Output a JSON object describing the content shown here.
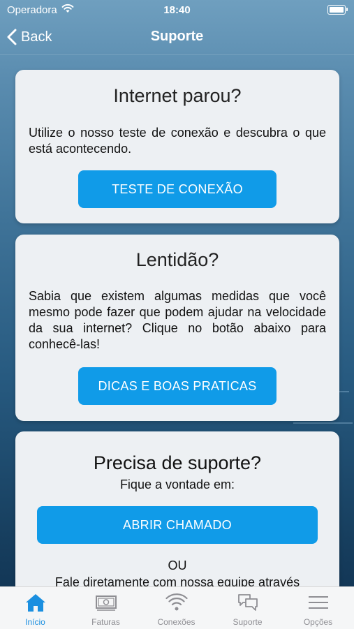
{
  "status_bar": {
    "carrier": "Operadora",
    "time": "18:40"
  },
  "nav": {
    "back_label": "Back",
    "title": "Suporte"
  },
  "cards": {
    "internet": {
      "title": "Internet parou?",
      "text": "Utilize o nosso teste de conexão e descubra o que está acontecendo.",
      "button": "TESTE DE CONEXÃO"
    },
    "lentidao": {
      "title": "Lentidão?",
      "text": "Sabia que existem algumas medidas que você mesmo pode fazer que podem ajudar na velocidade da sua internet? Clique no botão abaixo para conhecê-las!",
      "button": "DICAS E BOAS PRATICAS"
    },
    "suporte": {
      "title": "Precisa de suporte?",
      "subtitle": "Fique a vontade em:",
      "button": "ABRIR CHAMADO",
      "or": "OU",
      "footer": "Fale diretamente com nossa equipe através"
    }
  },
  "tabs": [
    {
      "label": "Início",
      "icon": "home-icon",
      "active": true
    },
    {
      "label": "Faturas",
      "icon": "invoice-icon",
      "active": false
    },
    {
      "label": "Conexões",
      "icon": "wifi-icon",
      "active": false
    },
    {
      "label": "Suporte",
      "icon": "chat-icon",
      "active": false
    },
    {
      "label": "Opções",
      "icon": "menu-icon",
      "active": false
    }
  ],
  "colors": {
    "accent": "#109be8",
    "tab_active": "#1a8fe0",
    "tab_inactive": "#8e8e93",
    "card_bg": "#edf0f3"
  }
}
